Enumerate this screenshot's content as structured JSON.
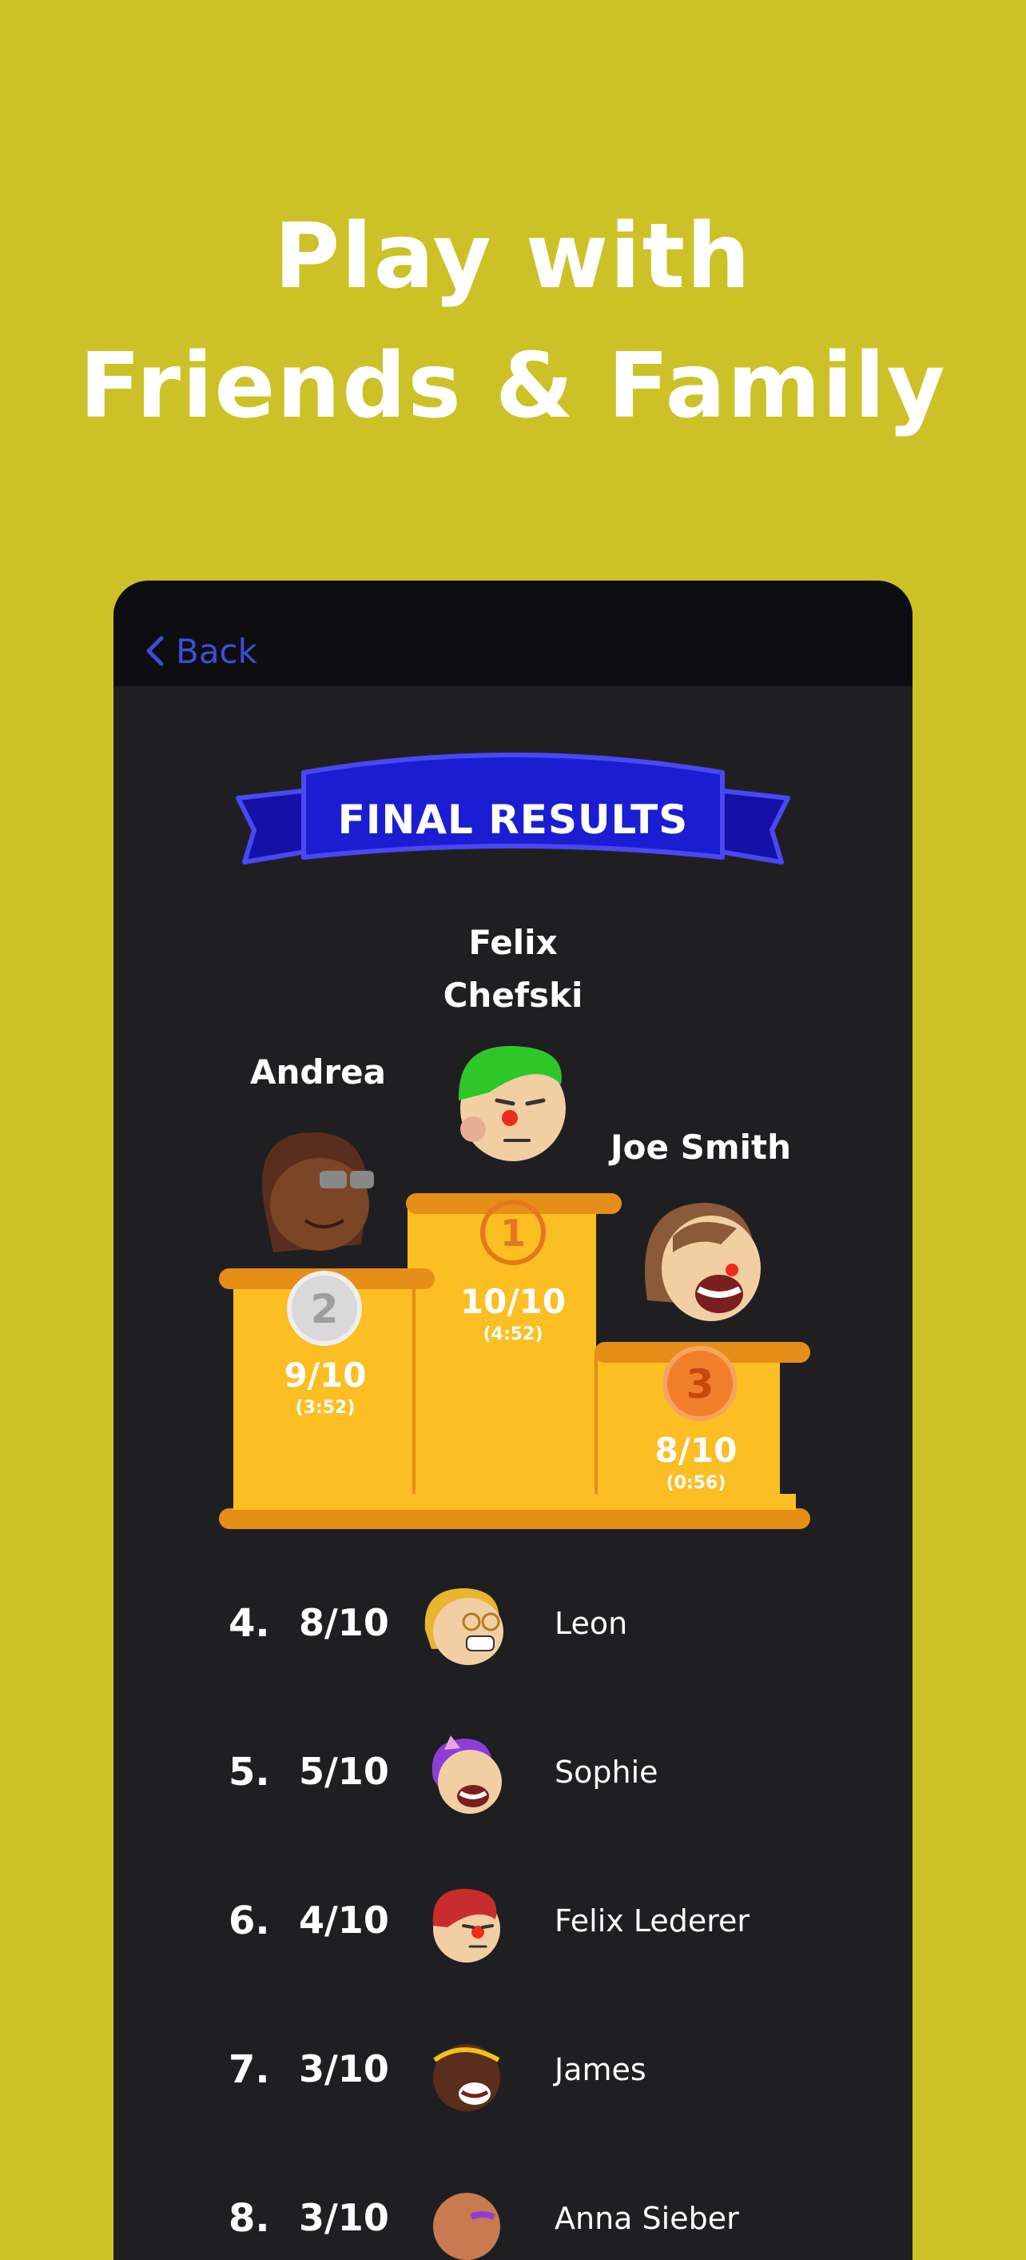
{
  "headline": {
    "line1": "Play with",
    "line2": "Friends & Family"
  },
  "app": {
    "back_label": "Back",
    "banner_title": "FINAL RESULTS",
    "podium": [
      {
        "place": "1",
        "name_line1": "Felix",
        "name_line2": "Chefski",
        "score": "10/10",
        "time": "(4:52)"
      },
      {
        "place": "2",
        "name": "Andrea",
        "score": "9/10",
        "time": "(3:52)"
      },
      {
        "place": "3",
        "name": "Joe Smith",
        "score": "8/10",
        "time": "(0:56)"
      }
    ],
    "ranking": [
      {
        "rank": "4.",
        "score": "8/10",
        "name": "Leon"
      },
      {
        "rank": "5.",
        "score": "5/10",
        "name": "Sophie"
      },
      {
        "rank": "6.",
        "score": "4/10",
        "name": "Felix Lederer"
      },
      {
        "rank": "7.",
        "score": "3/10",
        "name": "James"
      },
      {
        "rank": "8.",
        "score": "3/10",
        "name": "Anna Sieber"
      }
    ]
  },
  "colors": {
    "background": "#CCC227",
    "phone": "#1F1F22",
    "podium": "#FBBE23",
    "podium_trim": "#E58E18",
    "banner": "#1B1DD3",
    "back": "#3C4FD8"
  },
  "icons": [
    "chevron-left-icon",
    "gold-medal-icon",
    "silver-medal-icon",
    "bronze-medal-icon"
  ]
}
